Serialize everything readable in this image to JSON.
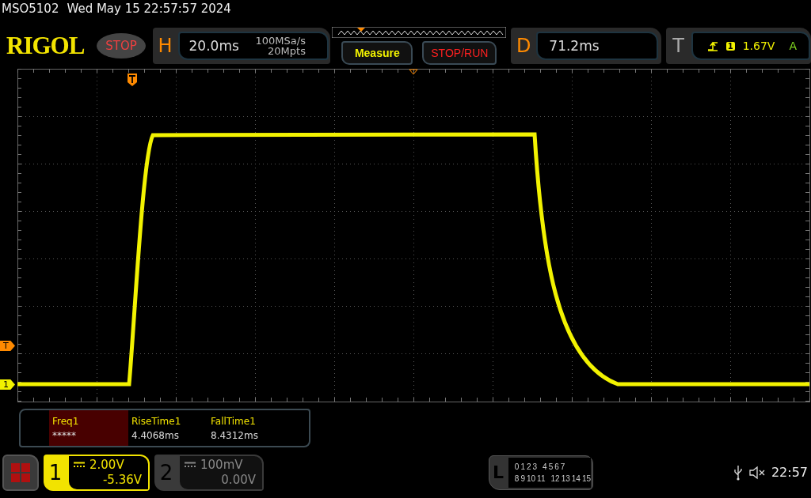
{
  "status_line": {
    "model": "MSO5102",
    "datetime": "Wed May 15 22:57:57 2024"
  },
  "logo": "RIGOL",
  "run_state": "STOP",
  "horizontal": {
    "label": "H",
    "timebase": "20.0ms",
    "sample_rate": "100MSa/s",
    "memory_depth": "20Mpts"
  },
  "buttons": [
    {
      "label": "Measure",
      "kind": "menu"
    },
    {
      "label": "STOP/RUN",
      "kind": "run"
    }
  ],
  "delay": {
    "label": "D",
    "value": "71.2ms"
  },
  "trigger": {
    "label": "T",
    "source": "1",
    "trigger_level": "1.67V",
    "mode": "A"
  },
  "markers": [
    {
      "label": "T",
      "kind": "trigger"
    },
    {
      "label": "1",
      "kind": "channel"
    }
  ],
  "measurements": [
    {
      "name": "Freq1",
      "value": "*****",
      "selected": true
    },
    {
      "name": "RiseTime1",
      "value": "4.4068ms",
      "selected": false
    },
    {
      "name": "FallTime1",
      "value": "8.4312ms",
      "selected": false
    }
  ],
  "channels": [
    {
      "number": "1",
      "scale": "2.00V",
      "offset": "-5.36V",
      "active": true
    },
    {
      "number": "2",
      "scale": "100mV",
      "offset": "0.00V",
      "active": false
    }
  ],
  "logic": {
    "label": "L",
    "row_1": [
      "0",
      "1",
      "2",
      "3",
      "4",
      "5",
      "6",
      "7"
    ],
    "row_2": [
      "8",
      "9",
      "10",
      "11",
      "12",
      "13",
      "14",
      "15"
    ]
  },
  "clock": "22:57"
}
